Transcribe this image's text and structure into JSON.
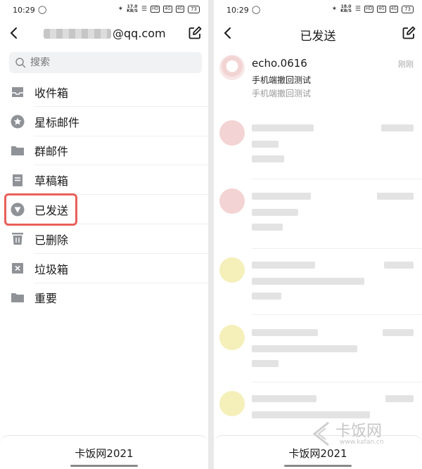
{
  "status_bar": {
    "time": "10:29",
    "left_speed": "17.0",
    "right_speed": "18.0",
    "speed_unit": "KB/S",
    "hd": "HD",
    "net_a": "4G",
    "net_b": "4G",
    "battery": "73"
  },
  "left": {
    "account_suffix": "@qq.com",
    "search_placeholder": "搜索",
    "folders": [
      {
        "label": "收件箱",
        "icon": "inbox-icon"
      },
      {
        "label": "星标邮件",
        "icon": "star-icon"
      },
      {
        "label": "群邮件",
        "icon": "group-folder-icon"
      },
      {
        "label": "草稿箱",
        "icon": "drafts-icon"
      },
      {
        "label": "已发送",
        "icon": "sent-icon"
      },
      {
        "label": "已删除",
        "icon": "trash-icon"
      },
      {
        "label": "垃圾箱",
        "icon": "spam-icon"
      },
      {
        "label": "重要",
        "icon": "important-folder-icon"
      }
    ],
    "bottom_label": "卡饭网2021"
  },
  "right": {
    "title": "已发送",
    "first_mail": {
      "sender": "echo.0616",
      "subject": "手机端撤回测试",
      "preview": "手机端撤回测试",
      "time": "刚刚"
    },
    "bottom_label": "卡饭网2021"
  },
  "watermark": {
    "name": "卡饭网",
    "url": "www.kafan.cn"
  },
  "colors": {
    "highlight": "#e8605a",
    "icon_gray": "#8f9297",
    "background": "#ffffff"
  }
}
